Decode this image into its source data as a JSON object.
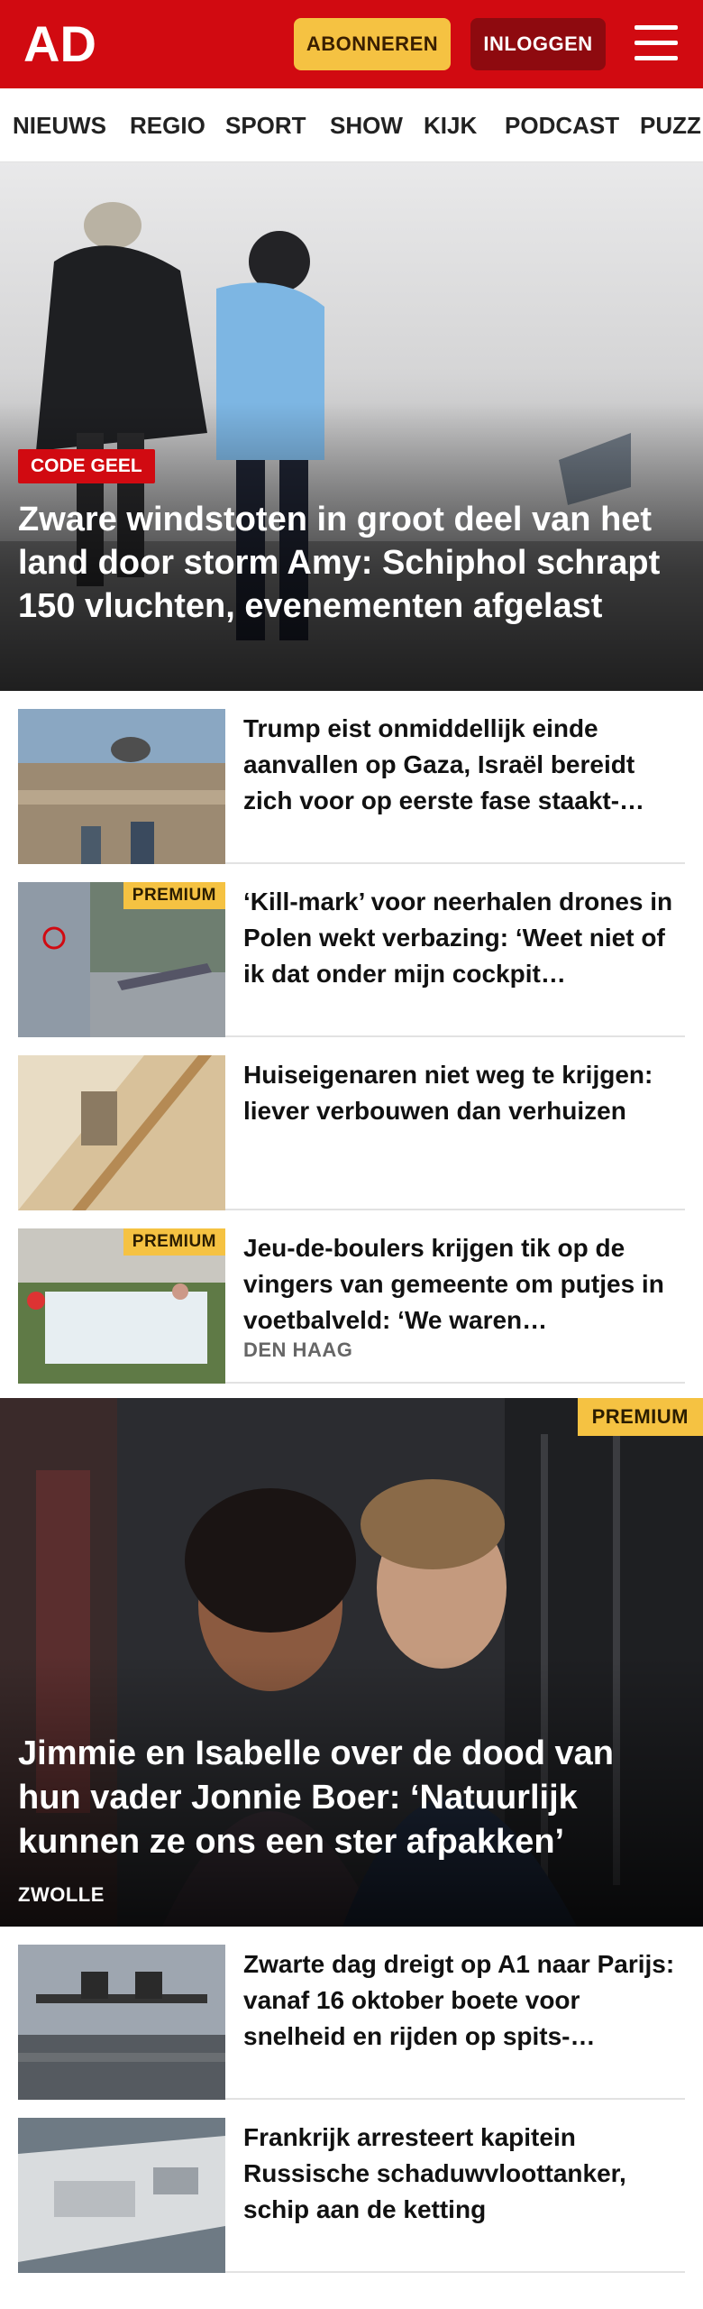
{
  "header": {
    "logo_text": "AD",
    "subscribe_label": "ABONNEREN",
    "login_label": "INLOGGEN",
    "menu_icon": "hamburger-menu-icon",
    "brand_color": "#d10a11"
  },
  "nav": {
    "items": [
      "NIEUWS",
      "REGIO",
      "SPORT",
      "SHOW",
      "KIJK",
      "PODCAST",
      "PUZZ"
    ]
  },
  "hero": {
    "tag": "CODE GEEL",
    "title": "Zware windstoten in groot deel van het land door storm Amy: Schiphol schrapt 150 vluchten, evenementen afgelast"
  },
  "articles": [
    {
      "title": "Trump eist onmiddellijk einde aanvallen op Gaza, Israël bereidt zich voor op eerste fase staakt-…",
      "premium": "",
      "location": ""
    },
    {
      "title": "‘Kill-mark’ voor neerhalen drones in Polen wekt verbazing: ‘Weet niet of ik dat onder mijn cockpit…",
      "premium": "PREMIUM",
      "location": ""
    },
    {
      "title": "Huiseigenaren niet weg te krijgen: liever verbouwen dan verhuizen",
      "premium": "",
      "location": ""
    },
    {
      "title": "Jeu-de-boulers krijgen tik op de vingers van gemeente om putjes in voetbalveld: ‘We waren…",
      "premium": "PREMIUM",
      "location": "DEN HAAG"
    }
  ],
  "feature": {
    "premium": "PREMIUM",
    "title": "Jimmie en Isabelle over de dood van hun vader Jonnie Boer: ‘Natuurlijk kunnen ze ons een ster afpakken’",
    "location": "ZWOLLE"
  },
  "more_articles": [
    {
      "title": "Zwarte dag dreigt op A1 naar Parijs: vanaf 16 oktober boete voor snelheid en rijden op spits-…"
    },
    {
      "title": "Frankrijk arresteert kapitein Russische schaduwvloottanker, schip aan de ketting"
    }
  ]
}
